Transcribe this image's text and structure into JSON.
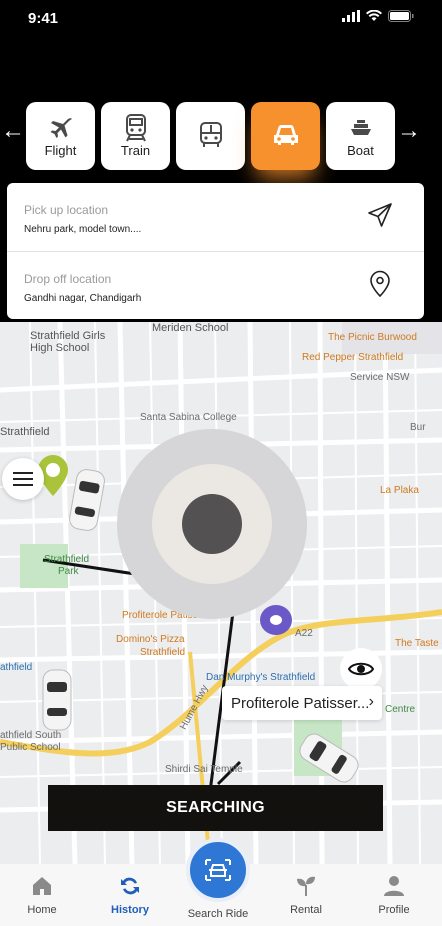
{
  "status": {
    "time": "9:41"
  },
  "modes": [
    {
      "label": "Flight",
      "icon": "plane-icon"
    },
    {
      "label": "Train",
      "icon": "train-icon"
    },
    {
      "label": "",
      "icon": "bus-icon"
    },
    {
      "label": "",
      "icon": "car-icon"
    },
    {
      "label": "Boat",
      "icon": "boat-icon"
    }
  ],
  "active_mode_index": 3,
  "pickup": {
    "label": "Pick up location",
    "value": "Nehru park, model town...."
  },
  "dropoff": {
    "label": "Drop off location",
    "value": "Gandhi nagar, Chandigarh"
  },
  "map": {
    "labels": {
      "l1": "Strathfield Girls",
      "l2": "High School",
      "l3": "Meriden School",
      "l4": "The Picnic Burwood",
      "l5": "Red Pepper Strathfield",
      "l6": "Service NSW",
      "l7": "Santa Sabina College",
      "l8": "Strathfield",
      "l9": "La Plaka",
      "l10": "Strathfield",
      "l11": "Park",
      "l12": "Profiterole Patisserie",
      "l13": "Domino's Pizza",
      "l14": "Strathfield",
      "l15": "The Taste of",
      "l16": "Dan Murphy's Strathfield",
      "l17": "athfield",
      "l18": "athfield South",
      "l19": "Public School",
      "l20": "Shirdi Sai Temple",
      "l21": "Centre",
      "l22": "Hume Hwy",
      "l23": "Bur",
      "l24": "A22"
    },
    "place_pill": "Profiterole Patisser..."
  },
  "searching_label": "SEARCHING",
  "tabs": {
    "home": "Home",
    "history": "History",
    "search": "Search Ride",
    "rental": "Rental",
    "profile": "Profile"
  },
  "colors": {
    "accent": "#f7912e",
    "primary": "#2f77d4",
    "active_tab": "#1f5fb8"
  }
}
